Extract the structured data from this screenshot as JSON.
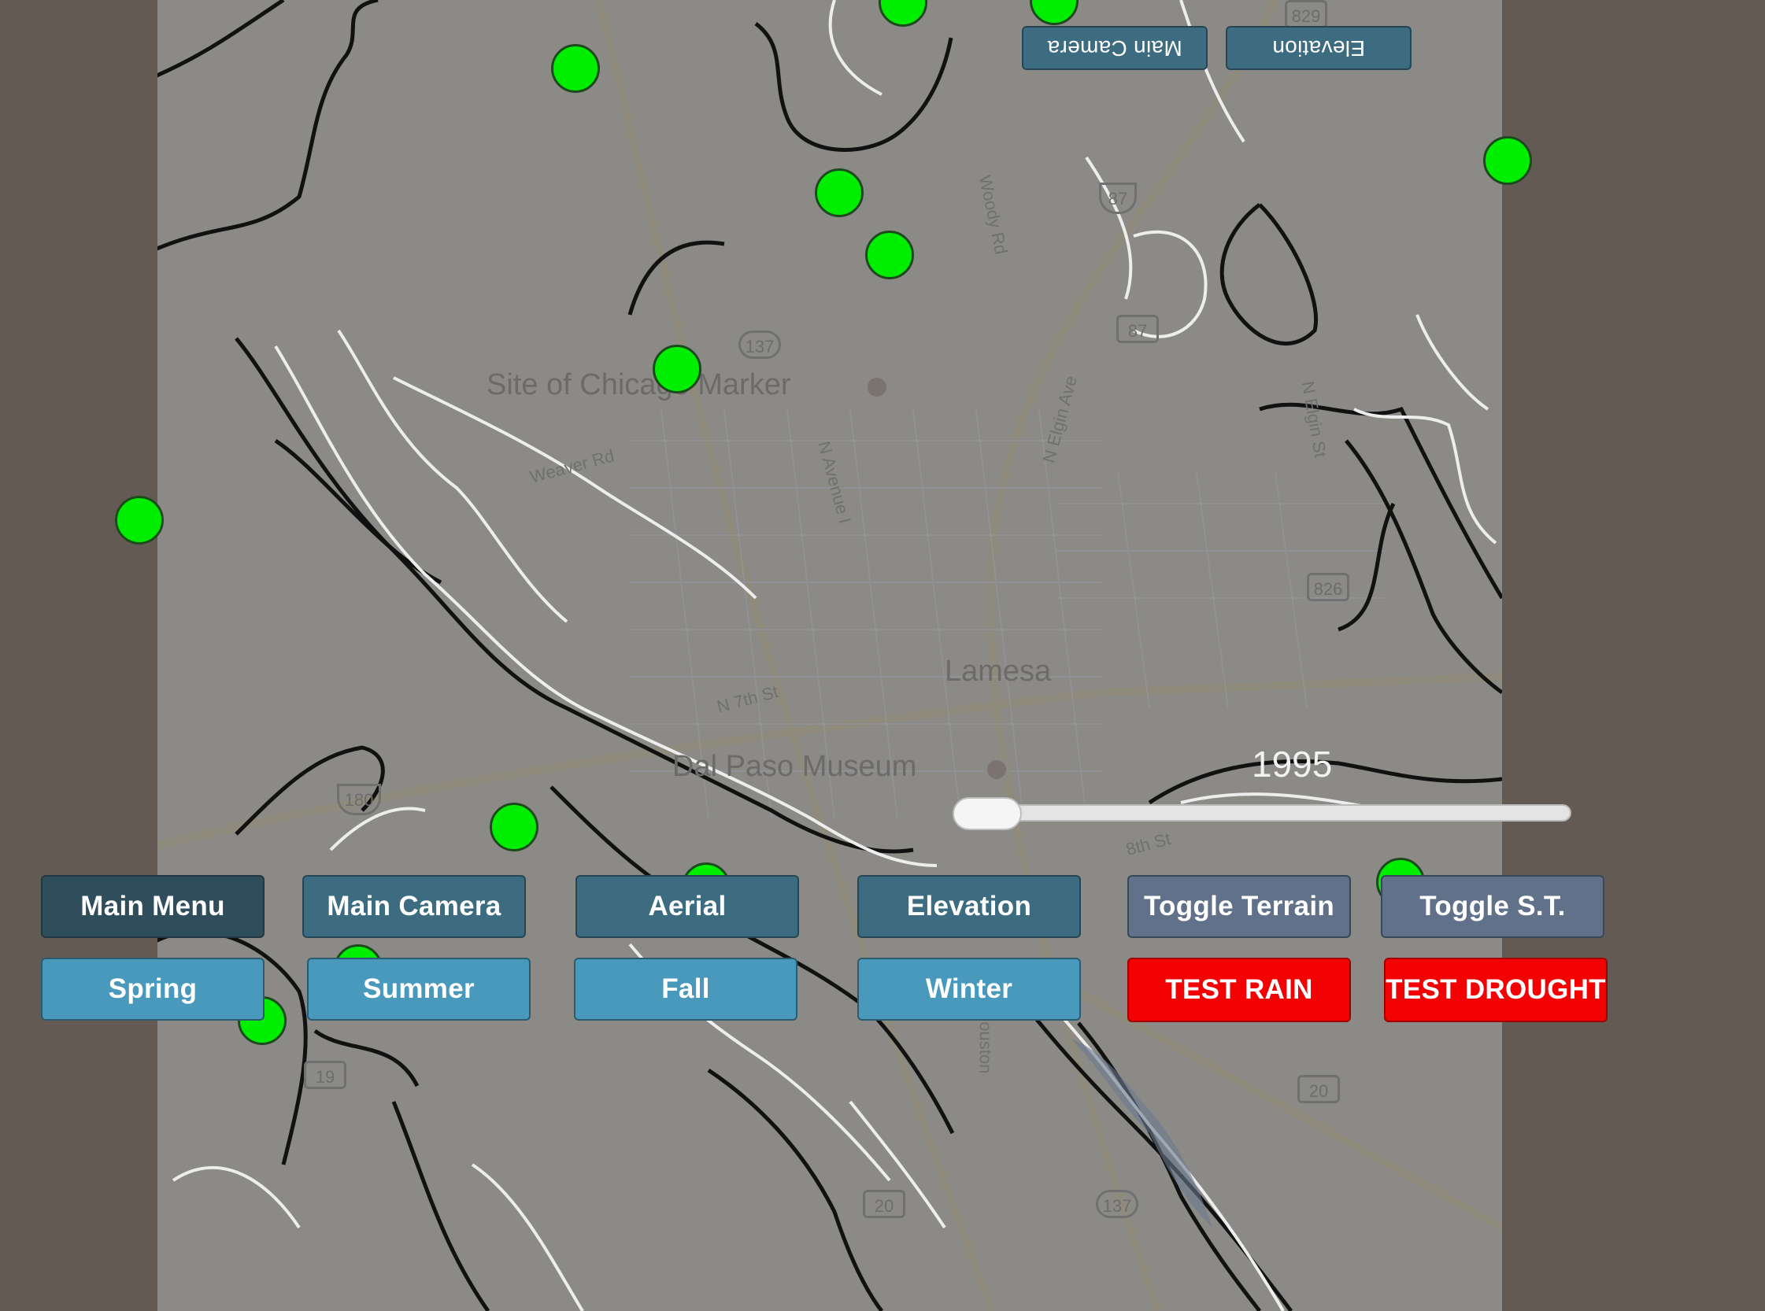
{
  "map": {
    "places": {
      "marker": "Site of Chicago Marker",
      "city": "Lamesa",
      "museum": "Dal Paso Museum"
    },
    "streets": {
      "weaver": "Weaver Rd",
      "avenue_i": "N Avenue I",
      "woody": "Woody Rd",
      "elgin": "N Elgin Ave",
      "seventh": "N 7th St",
      "eighth": "8th St",
      "elgin_st": "N Elgin St",
      "south_rd": "S Houston"
    },
    "shields": {
      "s137": "137",
      "s137b": "137",
      "s87": "87",
      "s826": "826",
      "s829": "829",
      "s180": "180",
      "s19": "19",
      "s20": "20",
      "s20b": "20",
      "s87b": "87"
    }
  },
  "top_controls": {
    "main_camera": "Main Camera",
    "elevation": "Elevation"
  },
  "year_slider": {
    "year": "1995",
    "position_fraction": 0.0
  },
  "buttons_row1": {
    "main_menu": "Main Menu",
    "main_camera": "Main Camera",
    "aerial": "Aerial",
    "elevation": "Elevation",
    "toggle_terrain": "Toggle Terrain",
    "toggle_st": "Toggle S.T."
  },
  "buttons_row2": {
    "spring": "Spring",
    "summer": "Summer",
    "fall": "Fall",
    "winter": "Winter",
    "test_rain": "TEST RAIN",
    "test_drought": "TEST DROUGHT"
  },
  "colors": {
    "background": "#635a53",
    "map_base": "#8b8a86",
    "marker_green": "#00ef00",
    "rain_red": "#f20202"
  }
}
